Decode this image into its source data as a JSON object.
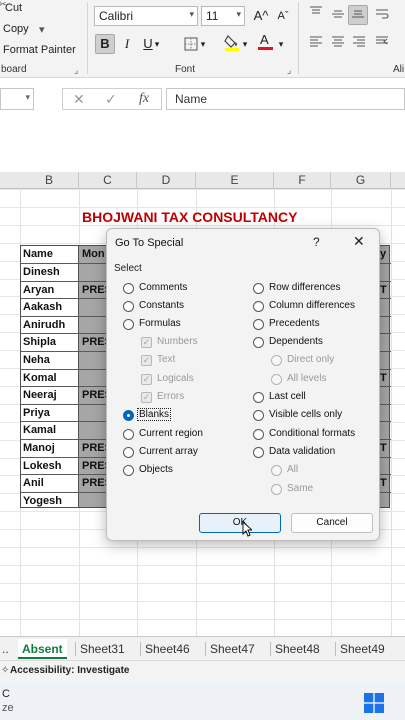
{
  "ribbon": {
    "clipboard": {
      "cut": "Cut",
      "copy": "Copy",
      "copy_dropdown": "▾",
      "format_painter": "Format Painter",
      "group": "board"
    },
    "font": {
      "name": "Calibri",
      "size": "11",
      "grow": "A^",
      "shrink": "Aˇ",
      "bold": "B",
      "italic": "I",
      "underline": "U",
      "group": "Font"
    },
    "alignment": {
      "group": "Ali"
    }
  },
  "formula_bar": {
    "cancel": "✕",
    "enter": "✓",
    "fx": "fx",
    "value": "Name"
  },
  "columns": [
    "B",
    "C",
    "D",
    "E",
    "F",
    "G"
  ],
  "sheet": {
    "title": "BHOJWANI TAX CONSULTANCY",
    "header_name": "Name",
    "header_mon": "Mon",
    "right_edge_y": "y",
    "names": [
      "Dinesh",
      "Aryan",
      "Aakash",
      "Anirudh",
      "Shipla",
      "Neha",
      "Komal",
      "Neeraj",
      "Priya",
      "Kamal",
      "Manoj",
      "Lokesh",
      "Anil",
      "Yogesh"
    ],
    "mon_values": [
      "",
      "PRES",
      "",
      "",
      "PRES",
      "",
      "",
      "PRES",
      "",
      "",
      "PRES",
      "PRES",
      "PRES",
      ""
    ],
    "right_edge": [
      "",
      "T",
      "",
      "",
      "",
      "",
      "T",
      "",
      "",
      "",
      "T",
      "",
      "T",
      ""
    ]
  },
  "dialog": {
    "title": "Go To Special",
    "help": "?",
    "close": "✕",
    "select_label": "Select",
    "left_options": [
      "Comments",
      "Constants",
      "Formulas",
      "Numbers",
      "Text",
      "Logicals",
      "Errors",
      "Blanks",
      "Current region",
      "Current array",
      "Objects"
    ],
    "right_options": [
      "Row differences",
      "Column differences",
      "Precedents",
      "Dependents",
      "Direct only",
      "All levels",
      "Last cell",
      "Visible cells only",
      "Conditional formats",
      "Data validation",
      "All",
      "Same"
    ],
    "ok": "OK",
    "cancel": "Cancel",
    "selected": "Blanks"
  },
  "tabs": {
    "overflow": "..",
    "items": [
      "Absent",
      "Sheet31",
      "Sheet46",
      "Sheet47",
      "Sheet48",
      "Sheet49"
    ],
    "active": "Absent"
  },
  "status": {
    "accessibility": "Accessibility: Investigate"
  },
  "taskbar": {
    "line1": "C",
    "line2": "ze"
  },
  "colors": {
    "accent": "#107c41",
    "dialog_accent": "#0067c0",
    "title_red": "#c00000",
    "font_color": "#e81123",
    "highlight": "#ffff00"
  }
}
